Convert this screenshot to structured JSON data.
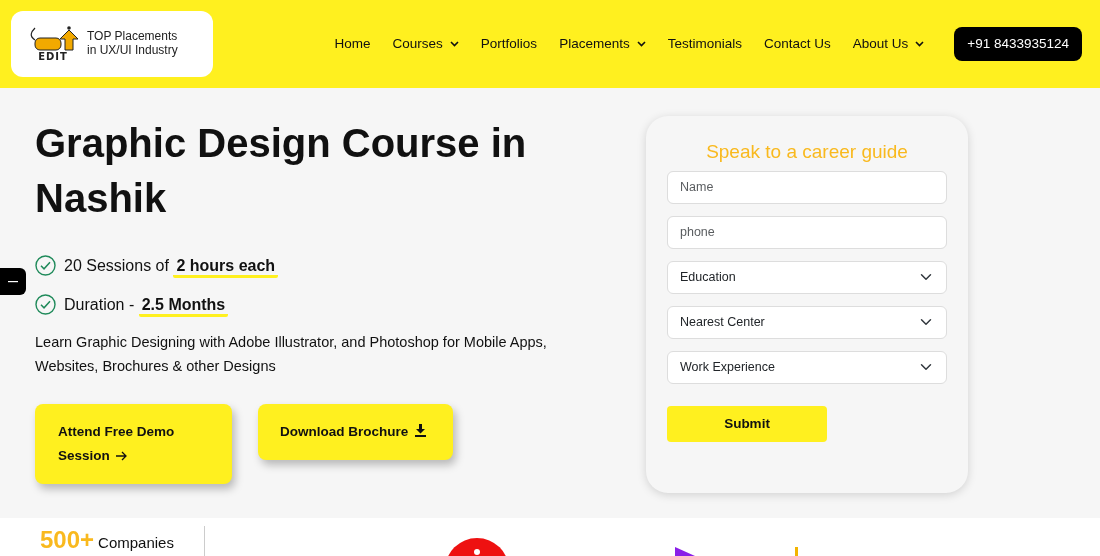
{
  "navbar": {
    "logo": {
      "mark": "EDIT",
      "line1": "TOP Placements",
      "line2": "in UX/UI Industry"
    },
    "items": [
      {
        "label": "Home",
        "dropdown": false
      },
      {
        "label": "Courses",
        "dropdown": true
      },
      {
        "label": "Portfolios",
        "dropdown": false
      },
      {
        "label": "Placements",
        "dropdown": true
      },
      {
        "label": "Testimonials",
        "dropdown": false
      },
      {
        "label": "Contact Us",
        "dropdown": false
      },
      {
        "label": "About Us",
        "dropdown": true
      }
    ],
    "phone": "+91 8433935124"
  },
  "hero": {
    "title": "Graphic Design Course in Nashik",
    "features": [
      {
        "text": "20 Sessions of",
        "highlight": "2 hours each"
      },
      {
        "text": "Duration -",
        "highlight": "2.5 Months"
      }
    ],
    "description": "Learn Graphic Designing with Adobe Illustrator, and Photoshop for Mobile Apps, Websites, Brochures & other Designs",
    "buttons": [
      {
        "label": "Attend Free Demo Session",
        "kind": "arrow"
      },
      {
        "label": "Download Brochure",
        "kind": "download"
      }
    ]
  },
  "form": {
    "title": "Speak to a career guide",
    "fields": [
      {
        "kind": "input",
        "placeholder": "Name"
      },
      {
        "kind": "input",
        "placeholder": "phone"
      },
      {
        "kind": "select",
        "value": "Education"
      },
      {
        "kind": "select",
        "value": "Nearest Center"
      },
      {
        "kind": "select",
        "value": "Work Experience"
      }
    ],
    "submit": "Submit"
  },
  "stats": {
    "number": "500+",
    "label": "Companies"
  }
}
